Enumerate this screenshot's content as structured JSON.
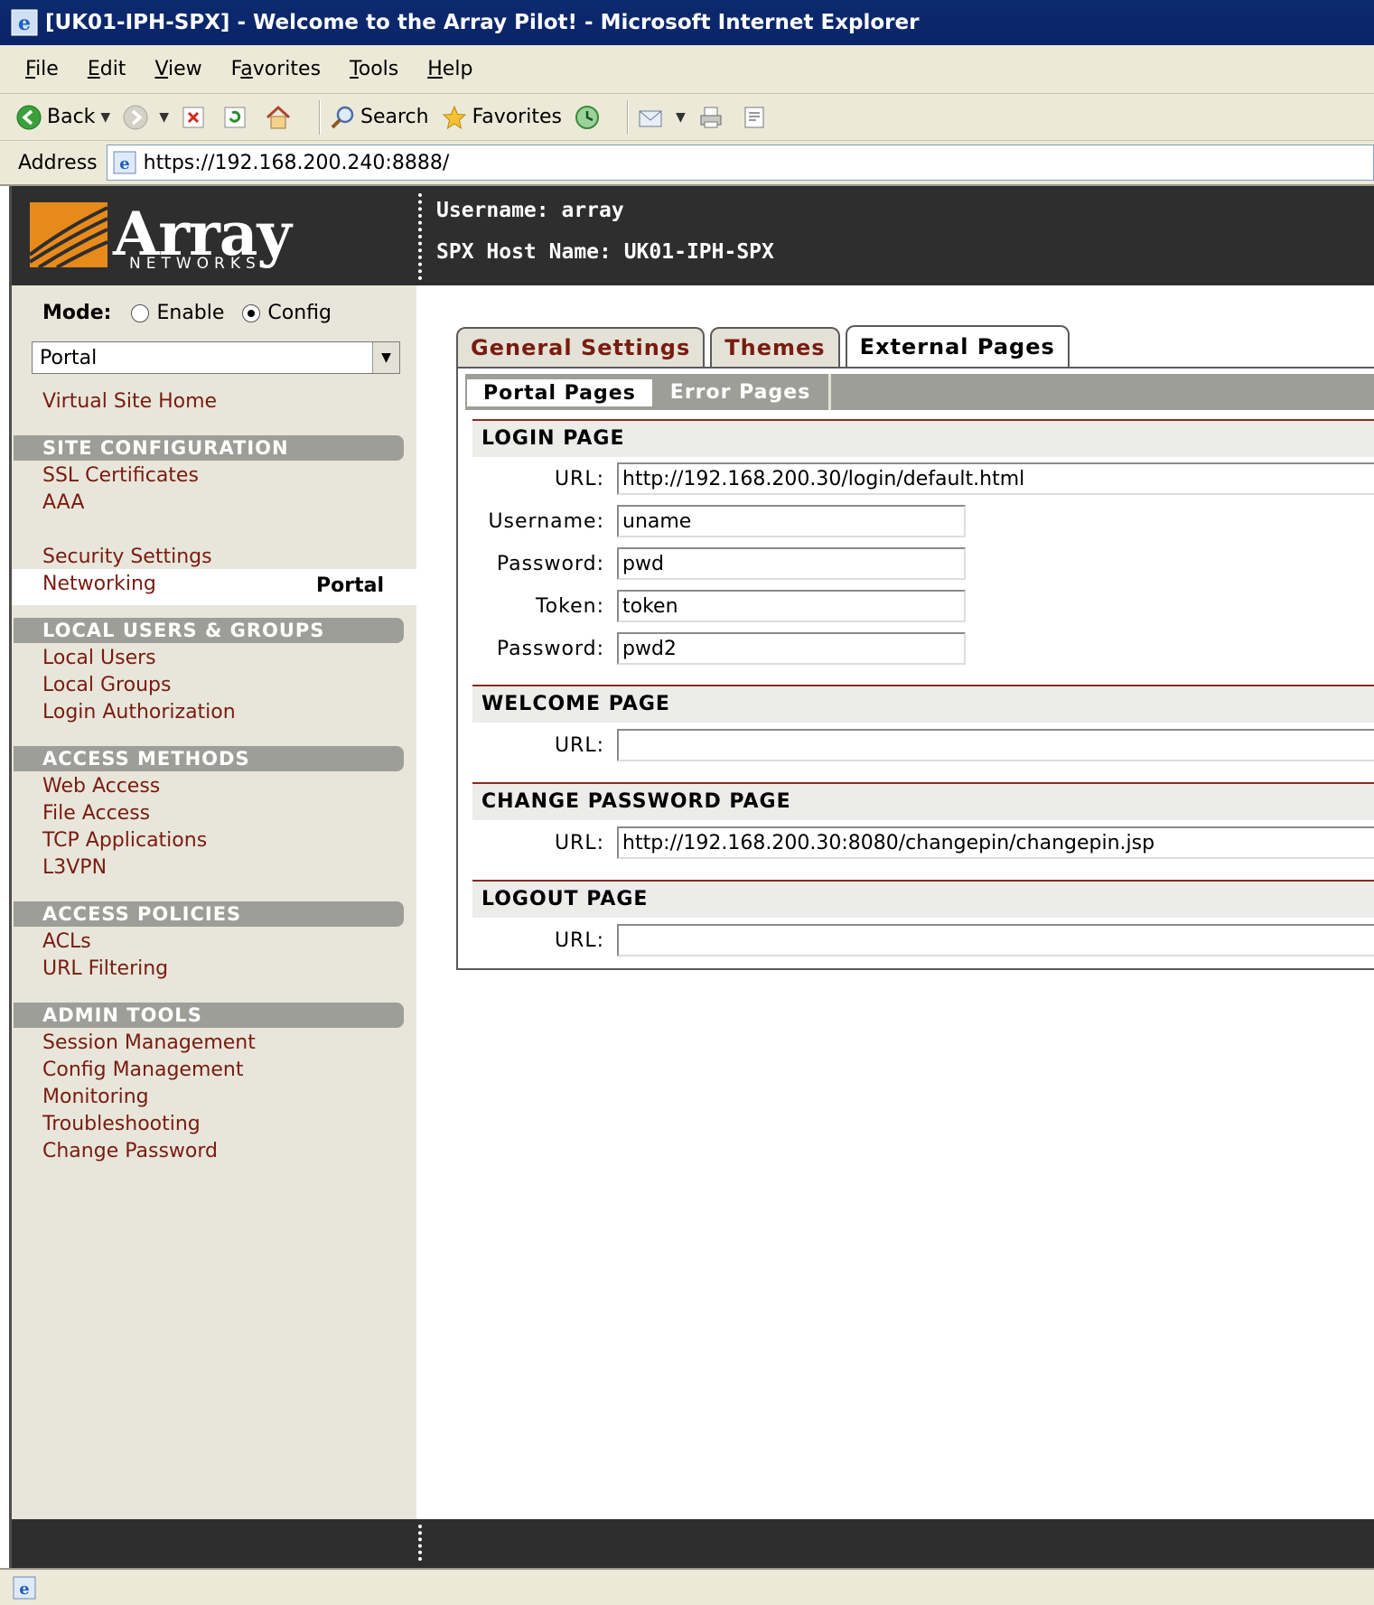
{
  "window": {
    "title": "[UK01-IPH-SPX] - Welcome to the Array Pilot! - Microsoft Internet Explorer"
  },
  "menu": [
    {
      "label": "File",
      "ul": "F",
      "rest": "ile"
    },
    {
      "label": "Edit",
      "ul": "E",
      "rest": "dit"
    },
    {
      "label": "View",
      "ul": "V",
      "rest": "iew"
    },
    {
      "label": "Favorites",
      "pre": "F",
      "ul": "a",
      "rest": "vorites"
    },
    {
      "label": "Tools",
      "ul": "T",
      "rest": "ools"
    },
    {
      "label": "Help",
      "ul": "H",
      "rest": "elp"
    }
  ],
  "toolbar": {
    "back_label": "Back",
    "search_label": "Search",
    "favorites_label": "Favorites"
  },
  "address": {
    "label": "Address",
    "url": "https://192.168.200.240:8888/"
  },
  "header": {
    "logo_text": "Array",
    "logo_sub": "NETWORKS",
    "username": "Username: array",
    "hostname": "SPX Host Name: UK01-IPH-SPX"
  },
  "sidebar": {
    "mode_label": "Mode:",
    "mode_options": [
      "Enable",
      "Config"
    ],
    "mode_selected": "Config",
    "select_value": "Portal",
    "home_link": "Virtual Site Home",
    "sections": {
      "site_config": {
        "title": "SITE CONFIGURATION",
        "items": [
          "SSL Certificates",
          "AAA"
        ],
        "current": "Portal",
        "after": [
          "Security Settings",
          "Networking"
        ]
      },
      "local_users": {
        "title": "LOCAL USERS & GROUPS",
        "items": [
          "Local Users",
          "Local Groups",
          "Login Authorization"
        ]
      },
      "access_methods": {
        "title": "ACCESS METHODS",
        "items": [
          "Web Access",
          "File Access",
          "TCP Applications",
          "L3VPN"
        ]
      },
      "access_policies": {
        "title": "ACCESS POLICIES",
        "items": [
          "ACLs",
          "URL Filtering"
        ]
      },
      "admin_tools": {
        "title": "ADMIN TOOLS",
        "items": [
          "Session Management",
          "Config Management",
          "Monitoring",
          "Troubleshooting",
          "Change Password"
        ]
      }
    }
  },
  "content": {
    "tabs": [
      "General Settings",
      "Themes",
      "External Pages"
    ],
    "active_tab": "External Pages",
    "subtabs": [
      "Portal Pages",
      "Error Pages"
    ],
    "active_subtab": "Portal Pages",
    "login": {
      "title": "LOGIN PAGE",
      "url_label": "URL:",
      "url": "http://192.168.200.30/login/default.html",
      "username_label": "Username:",
      "username": "uname",
      "password_label": "Password:",
      "password": "pwd",
      "token_label": "Token:",
      "token": "token",
      "password2_label": "Password:",
      "password2": "pwd2"
    },
    "welcome": {
      "title": "WELCOME PAGE",
      "url_label": "URL:",
      "url": ""
    },
    "change_password": {
      "title": "CHANGE PASSWORD PAGE",
      "url_label": "URL:",
      "url": "http://192.168.200.30:8080/changepin/changepin.jsp"
    },
    "logout": {
      "title": "LOGOUT PAGE",
      "url_label": "URL:",
      "url": ""
    }
  },
  "colors": {
    "link": "#7a1b10",
    "section_bar": "#9e9e98",
    "header_bg": "#2e2e2e",
    "title_bar": "#0a246a"
  }
}
